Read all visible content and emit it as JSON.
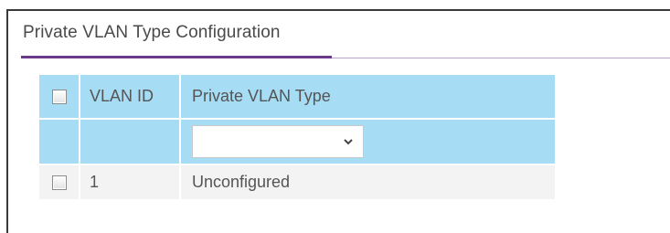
{
  "panel": {
    "title": "Private VLAN Type Configuration"
  },
  "table": {
    "columns": {
      "vlan_id": "VLAN ID",
      "private_vlan_type": "Private VLAN Type"
    },
    "filter": {
      "private_vlan_type_selected": ""
    },
    "rows": [
      {
        "vlan_id": "1",
        "private_vlan_type": "Unconfigured",
        "checked": false
      }
    ]
  },
  "icons": {
    "select_chevron": "chevron-down-icon"
  },
  "colors": {
    "header_bg": "#a6dcf4",
    "row_bg": "#f3f3f3",
    "title_underline": "#6b3a8b"
  }
}
